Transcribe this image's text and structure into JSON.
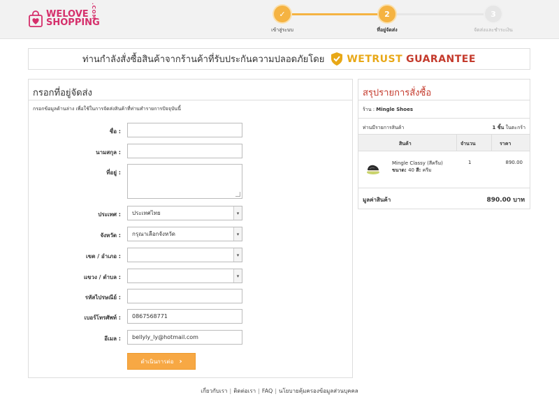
{
  "header": {
    "logo_line1": "WELOVE",
    "logo_line2": "SHOPPING",
    "logo_com": ".COM",
    "steps": [
      {
        "number": "✓",
        "label": "เข้าสู่ระบบ"
      },
      {
        "number": "2",
        "label": "ที่อยู่จัดส่ง"
      },
      {
        "number": "3",
        "label": "จัดส่งและชำระเงิน"
      }
    ]
  },
  "banner": {
    "text": "ท่านกำลังสั่งซื้อสินค้าจากร้านค้าที่รับประกันความปลอดภัยโดย",
    "brand1": "WETRUST",
    "brand2": "GUARANTEE"
  },
  "form": {
    "title": "กรอกที่อยู่จัดส่ง",
    "description": "กรอกข้อมูลด้านล่าง เพื่อใช้ในการจัดส่งสินค้าที่ท่านทำรายการปัจจุบันนี้",
    "fields": {
      "first_name": {
        "label": "ชื่อ :",
        "value": ""
      },
      "last_name": {
        "label": "นามสกุล :",
        "value": ""
      },
      "address": {
        "label": "ที่อยู่ :",
        "value": ""
      },
      "country": {
        "label": "ประเทศ :",
        "value": "ประเทศไทย"
      },
      "province": {
        "label": "จังหวัด :",
        "value": "กรุณาเลือกจังหวัด"
      },
      "district": {
        "label": "เขต / อำเภอ :",
        "value": ""
      },
      "subdistrict": {
        "label": "แขวง / ตำบล :",
        "value": ""
      },
      "postcode": {
        "label": "รหัสไปรษณีย์ :",
        "value": ""
      },
      "phone": {
        "label": "เบอร์โทรศัพท์ :",
        "value": "0867568771"
      },
      "email": {
        "label": "อีเมล :",
        "value": "bellyly_ly@hotmail.com"
      }
    },
    "submit_label": "ดำเนินการต่อ",
    "submit_chevron": "›"
  },
  "summary": {
    "title": "สรุปรายการสั่งซื้อ",
    "shop_label": "ร้าน :",
    "shop_name": "Mingle Shoes",
    "count_label": "ท่านมีรายการสินค้า",
    "count_number": "1 ชิ้น",
    "count_suffix": "ในตะกร้า",
    "columns": [
      "สินค้า",
      "จำนวน",
      "ราคา"
    ],
    "item": {
      "name": "Mingle Classy (สีครีม)",
      "size_label": "ขนาด:",
      "size_value": "40",
      "color_label": "สี:",
      "color_value": "ครีม",
      "qty": "1",
      "price": "890.00"
    },
    "total_label": "มูลค่าสินค้า",
    "total_value": "890.00 บาท"
  },
  "footer": {
    "links": [
      "เกี่ยวกับเรา",
      "ติดต่อเรา",
      "FAQ",
      "นโยบายคุ้มครองข้อมูลส่วนบุคคล"
    ],
    "separator": "|"
  },
  "colors": {
    "accent": "#f5b342",
    "brand_pink": "#d52f6b",
    "summary_red": "#c43a2c",
    "button_orange": "#f7a844"
  }
}
